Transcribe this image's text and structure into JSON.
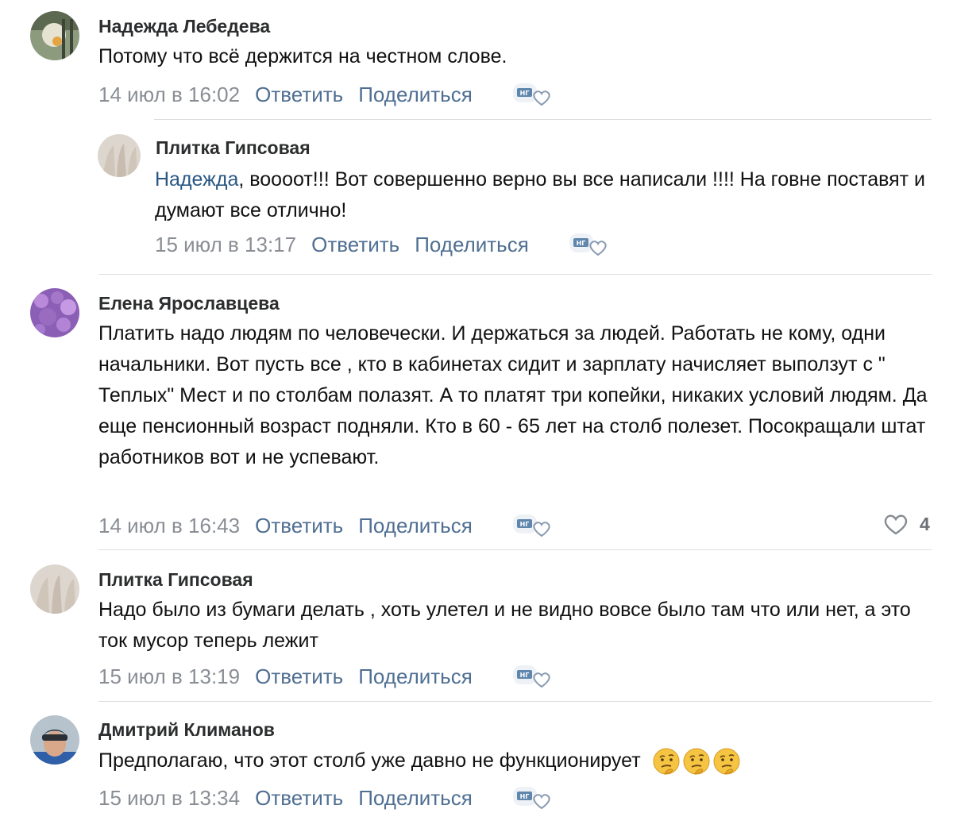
{
  "actions": {
    "reply": "Ответить",
    "share": "Поделиться"
  },
  "comments": [
    {
      "author": "Надежда Лебедева",
      "text": "Потому что всё держится на честном слове.",
      "date": "14 июл в 16:02"
    },
    {
      "author": "Плитка Гипсовая",
      "mention": "Надежда",
      "text": ", воооот!!! Вот совершенно верно вы все написали !!!! На говне поставят и думают все отлично!",
      "date": "15 июл в 13:17"
    },
    {
      "author": "Елена Ярославцева",
      "text": "Платить надо людям по человечески. И держаться за людей. Работать не кому, одни начальники. Вот пусть все , кто в кабинетах сидит и зарплату начисляет выползут с \" Теплых\" Мест и по столбам полазят. А то платят три копейки, никаких условий людям. Да еще пенсионный возраст подняли. Кто в 60 - 65 лет на столб полезет. Посокращали штат работников вот и не успевают.",
      "date": "14 июл в 16:43",
      "likes": "4"
    },
    {
      "author": "Плитка Гипсовая",
      "text": "Надо было из бумаги делать , хоть улетел и не видно вовсе было там что или нет, а это ток мусор теперь лежит",
      "date": "15 июл в 13:19"
    },
    {
      "author": "Дмитрий Климанов",
      "text": "Предполагаю, что этот столб уже давно не функционирует",
      "date": "15 июл в 13:34",
      "emoji": "thinking-face-icon"
    }
  ]
}
